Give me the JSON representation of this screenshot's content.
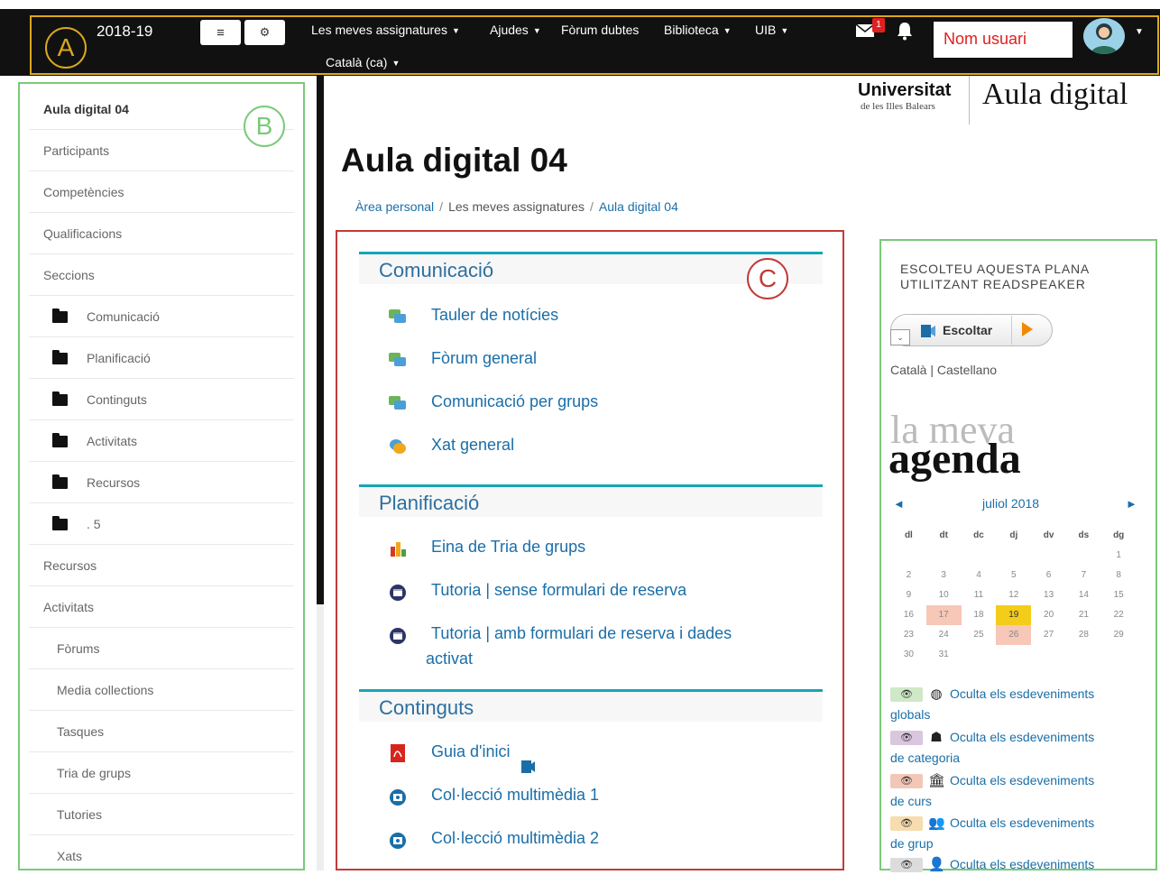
{
  "topbar": {
    "year": "2018-19",
    "annotation_a": "A",
    "nav": {
      "assignatures": "Les meves assignatures",
      "ajudes": "Ajudes",
      "forum": "Fòrum dubtes",
      "biblioteca": "Biblioteca",
      "uib": "UIB",
      "language": "Català (ca)"
    },
    "mail_badge": "1",
    "username": "Nom usuari",
    "menu_icon": "hamburger-icon",
    "gears_icon": "gears-icon",
    "accent_color": "#d9a81e"
  },
  "sidebar": {
    "annotation_b": "B",
    "accent_color": "#7bc97a",
    "items": [
      {
        "label": "Aula digital 04"
      },
      {
        "label": "Participants"
      },
      {
        "label": "Competències"
      },
      {
        "label": "Qualificacions"
      },
      {
        "label": "Seccions"
      },
      {
        "label": "Comunicació"
      },
      {
        "label": "Planificació"
      },
      {
        "label": "Continguts"
      },
      {
        "label": "Activitats"
      },
      {
        "label": "Recursos"
      },
      {
        "label": "5"
      },
      {
        "label": "Recursos"
      },
      {
        "label": "Activitats"
      },
      {
        "label": "Fòrums"
      },
      {
        "label": "Media collections"
      },
      {
        "label": "Tasques"
      },
      {
        "label": "Tria de grups"
      },
      {
        "label": "Tutories"
      },
      {
        "label": "Xats"
      }
    ]
  },
  "logo": {
    "university": "Universitat",
    "university_sub": "de les Illes Balears",
    "title": "Aula digital"
  },
  "main": {
    "title": "Aula digital 04",
    "breadcrumb": [
      "Àrea personal",
      "Les meves assignatures",
      "Aula digital 04"
    ],
    "annotation_c": "C",
    "accent_color": "#c23a3a",
    "sections": [
      {
        "title": "Comunicació",
        "activities": [
          {
            "label": "Tauler de notícies",
            "icon": "forum-icon"
          },
          {
            "label": "Fòrum general",
            "icon": "forum-icon"
          },
          {
            "label": "Comunicació per grups",
            "icon": "forum-icon"
          },
          {
            "label": "Xat general",
            "icon": "chat-icon"
          }
        ]
      },
      {
        "title": "Planificació",
        "activities": [
          {
            "label": "Eina de Tria de grups",
            "icon": "group-choice-icon"
          },
          {
            "label": "Tutoria | sense formulari de reserva",
            "icon": "scheduler-icon"
          },
          {
            "label": "Tutoria | amb formulari de reserva i dades",
            "label2": "activat",
            "icon": "scheduler-icon"
          }
        ]
      },
      {
        "title": "Continguts",
        "activities": [
          {
            "label": "Guia d'inici",
            "icon": "pdf-icon"
          },
          {
            "label": "Col·lecció multimèdia 1",
            "icon": "media-collection-icon"
          },
          {
            "label": "Col·lecció multimèdia 2",
            "icon": "media-collection-icon"
          }
        ]
      }
    ]
  },
  "right": {
    "readspeaker_title_1": "ESCOLTEU AQUESTA PLANA",
    "readspeaker_title_2": "UTILITZANT READSPEAKER",
    "escoltar": "Escoltar",
    "languages": "Català | Castellano",
    "agenda_line1": "la meva",
    "agenda_line2": "agenda",
    "calendar": {
      "month": "juliol 2018",
      "weekdays": [
        "dl",
        "dt",
        "dc",
        "dj",
        "dv",
        "ds",
        "dg"
      ],
      "weeks": [
        [
          "",
          "",
          "",
          "",
          "",
          "",
          "1"
        ],
        [
          "2",
          "3",
          "4",
          "5",
          "6",
          "7",
          "8"
        ],
        [
          "9",
          "10",
          "11",
          "12",
          "13",
          "14",
          "15"
        ],
        [
          "16",
          "17",
          "18",
          "19",
          "20",
          "21",
          "22"
        ],
        [
          "23",
          "24",
          "25",
          "26",
          "27",
          "28",
          "29"
        ],
        [
          "30",
          "31",
          "",
          "",
          "",
          "",
          ""
        ]
      ],
      "highlight_red": [
        "17",
        "26"
      ],
      "highlight_today": "19"
    },
    "events": [
      {
        "line1": "Oculta els esdeveniments",
        "line2": "globals",
        "eye_color": "#cfe8c8",
        "icon": "globe-icon",
        "glyph": "◍"
      },
      {
        "line1": "Oculta els esdeveniments",
        "line2": "de categoria",
        "eye_color": "#d9c6df",
        "icon": "cubes-icon",
        "glyph": "☗"
      },
      {
        "line1": "Oculta els esdeveniments",
        "line2": "de curs",
        "eye_color": "#f3c7b8",
        "icon": "institution-icon",
        "glyph": "🏛"
      },
      {
        "line1": "Oculta els esdeveniments",
        "line2": "de grup",
        "eye_color": "#f6dcae",
        "icon": "group-icon",
        "glyph": "👥"
      },
      {
        "line1": "Oculta els esdeveniments",
        "line2": "",
        "eye_color": "#dcdcdc",
        "icon": "user-icon",
        "glyph": "👤"
      }
    ]
  }
}
